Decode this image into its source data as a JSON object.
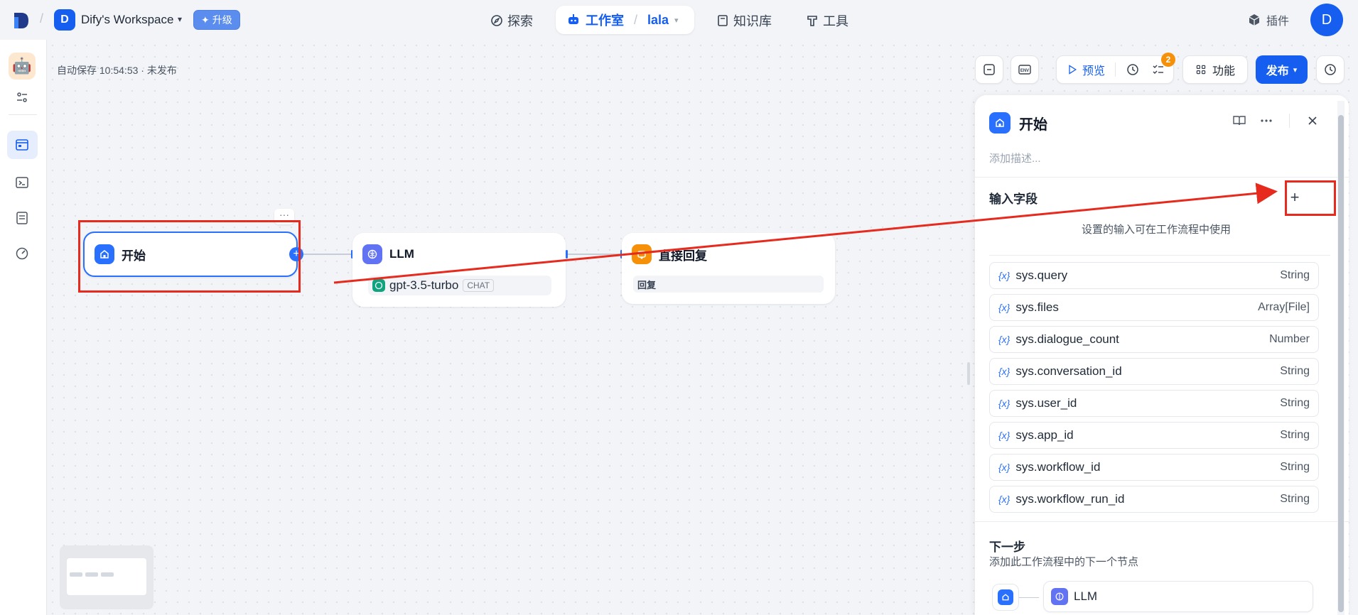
{
  "topbar": {
    "workspace_initial": "D",
    "workspace_name": "Dify's Workspace",
    "upgrade_label": "升级",
    "nav_explore": "探索",
    "nav_studio": "工作室",
    "nav_app": "lala",
    "nav_knowledge": "知识库",
    "nav_tools": "工具",
    "plugins": "插件",
    "avatar_initial": "D"
  },
  "canvas": {
    "autosave": "自动保存 10:54:53 · 未发布",
    "preview_label": "预览",
    "checklist_badge": "2",
    "features_label": "功能",
    "publish_label": "发布"
  },
  "nodes": {
    "start": {
      "title": "开始"
    },
    "llm": {
      "title": "LLM",
      "model": "gpt-3.5-turbo",
      "mode": "CHAT"
    },
    "reply": {
      "title": "直接回复",
      "tag": "回复"
    }
  },
  "panel": {
    "title": "开始",
    "description_placeholder": "添加描述...",
    "input_fields_title": "输入字段",
    "input_hint": "设置的输入可在工作流程中使用",
    "variables": [
      {
        "name": "sys.query",
        "type": "String"
      },
      {
        "name": "sys.files",
        "type": "Array[File]"
      },
      {
        "name": "sys.dialogue_count",
        "type": "Number"
      },
      {
        "name": "sys.conversation_id",
        "type": "String"
      },
      {
        "name": "sys.user_id",
        "type": "String"
      },
      {
        "name": "sys.app_id",
        "type": "String"
      },
      {
        "name": "sys.workflow_id",
        "type": "String"
      },
      {
        "name": "sys.workflow_run_id",
        "type": "String"
      }
    ],
    "var_symbol": "{x}",
    "next_title": "下一步",
    "next_desc": "添加此工作流程中的下一个节点",
    "next_node": "LLM"
  },
  "colors": {
    "primary": "#155eef",
    "accent": "#2970ff",
    "annotation": "#e62a1e",
    "reply_orange": "#f79009"
  }
}
